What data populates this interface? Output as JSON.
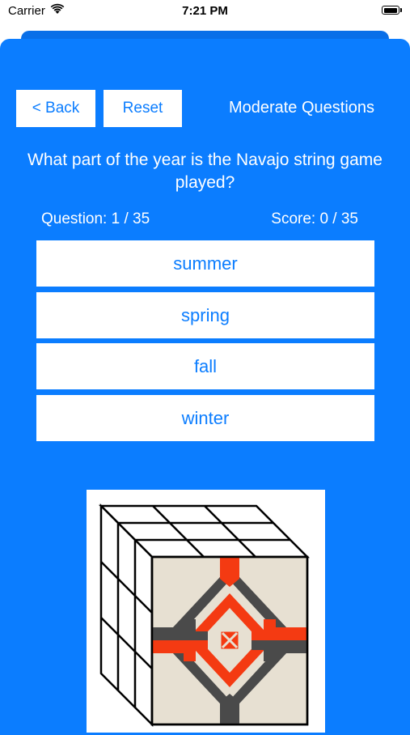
{
  "status": {
    "carrier": "Carrier",
    "time": "7:21 PM"
  },
  "toolbar": {
    "back_label": "< Back",
    "reset_label": "Reset",
    "mode_title": "Moderate Questions"
  },
  "quiz": {
    "question": "What part of the year is the Navajo string game played?",
    "question_counter": "Question: 1 / 35",
    "score": "Score: 0 / 35",
    "answers": [
      "summer",
      "spring",
      "fall",
      "winter"
    ]
  },
  "colors": {
    "accent": "#0b7dff",
    "pattern_red": "#f43a12",
    "pattern_dark": "#4a4a4a",
    "pattern_bg": "#e7e0d2"
  },
  "icons": [
    "wifi-icon",
    "battery-icon",
    "navajo-cube-illustration"
  ]
}
